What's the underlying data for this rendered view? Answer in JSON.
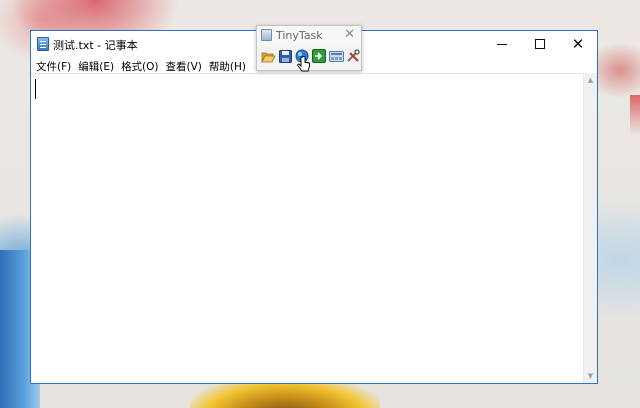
{
  "notepad": {
    "title": "测试.txt - 记事本",
    "menu": [
      "文件(F)",
      "编辑(E)",
      "格式(O)",
      "查看(V)",
      "帮助(H)"
    ],
    "content": ""
  },
  "tinytask": {
    "title": "TinyTask",
    "tools": [
      "open-icon",
      "save-icon",
      "record-icon",
      "play-icon",
      "compile-icon",
      "prefs-icon"
    ]
  },
  "colors": {
    "window_border": "#2b74c9",
    "record_blue": "#2a7fd4",
    "play_green": "#2f9a3a"
  }
}
